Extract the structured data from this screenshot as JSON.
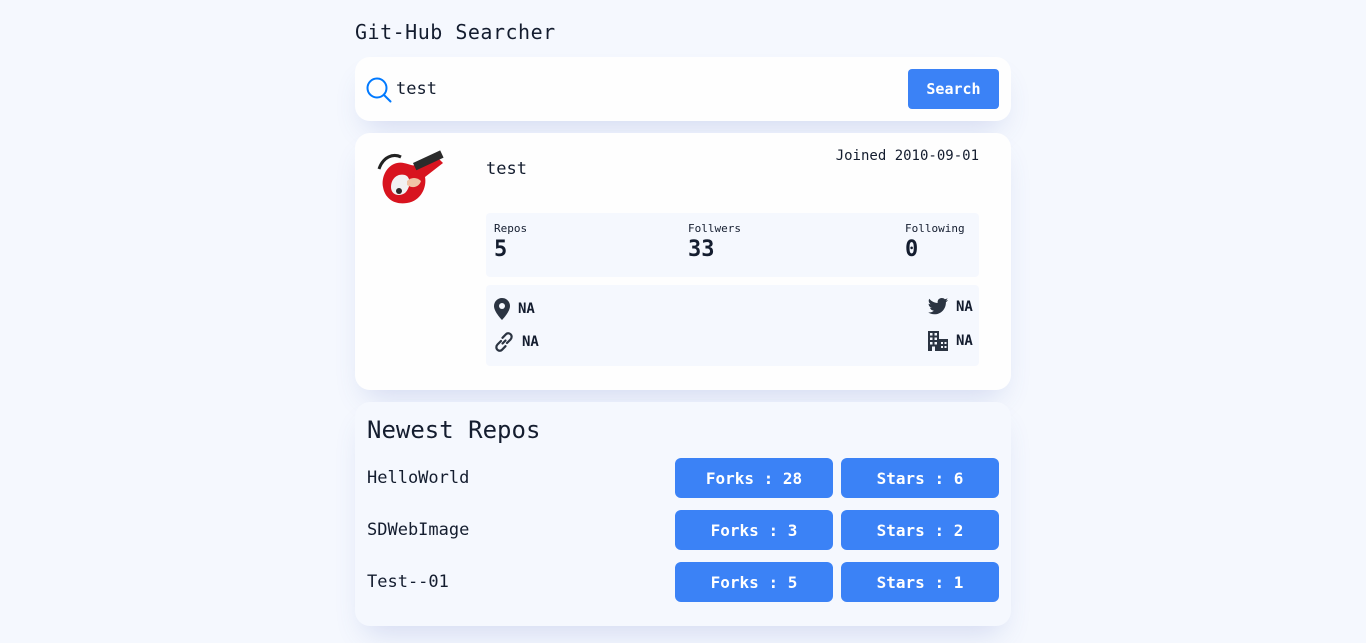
{
  "app": {
    "title": "Git-Hub Searcher"
  },
  "search": {
    "value": "test",
    "button_label": "Search"
  },
  "profile": {
    "username": "test",
    "joined": "Joined 2010-09-01",
    "stats": {
      "repos_label": "Repos",
      "repos_value": "5",
      "followers_label": "Follwers",
      "followers_value": "33",
      "following_label": "Following",
      "following_value": "0"
    },
    "links": {
      "location": "NA",
      "website": "NA",
      "twitter": "NA",
      "company": "NA"
    }
  },
  "repos": {
    "title": "Newest Repos",
    "items": [
      {
        "name": "HelloWorld",
        "forks": "Forks : 28",
        "stars": "Stars : 6"
      },
      {
        "name": "SDWebImage",
        "forks": "Forks : 3",
        "stars": "Stars : 2"
      },
      {
        "name": "Test--01",
        "forks": "Forks : 5",
        "stars": "Stars : 1"
      }
    ]
  },
  "colors": {
    "accent": "#3b82f6",
    "background": "#f5f8fe",
    "text": "#141d2f"
  },
  "icons": [
    "search-icon",
    "location-icon",
    "link-icon",
    "twitter-icon",
    "company-icon"
  ]
}
